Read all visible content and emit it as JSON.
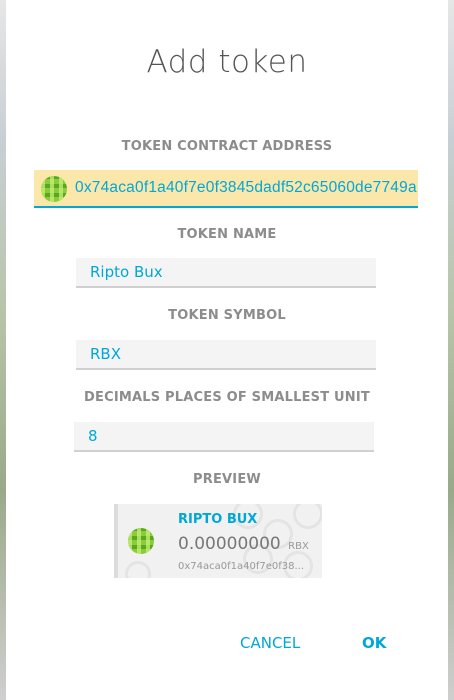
{
  "dialog": {
    "title": "Add token"
  },
  "fields": {
    "address": {
      "label": "TOKEN CONTRACT ADDRESS",
      "value": "0x74aca0f1a40f7e0f3845dadf52c65060de7749a"
    },
    "name": {
      "label": "TOKEN NAME",
      "value": "Ripto Bux"
    },
    "symbol": {
      "label": "TOKEN SYMBOL",
      "value": "RBX"
    },
    "decimals": {
      "label": "DECIMALS PLACES OF SMALLEST UNIT",
      "value": "8"
    }
  },
  "preview": {
    "label": "PREVIEW",
    "token_name": "RIPTO BUX",
    "amount": "0.00000000",
    "unit": "RBX",
    "address": "0x74aca0f1a40f7e0f38..."
  },
  "buttons": {
    "cancel": "CANCEL",
    "ok": "OK"
  },
  "colors": {
    "accent": "#00a7d8",
    "address_highlight": "#fbe7a9",
    "identicon": "#6cb82c"
  },
  "icons": {
    "token": "identicon-icon"
  }
}
